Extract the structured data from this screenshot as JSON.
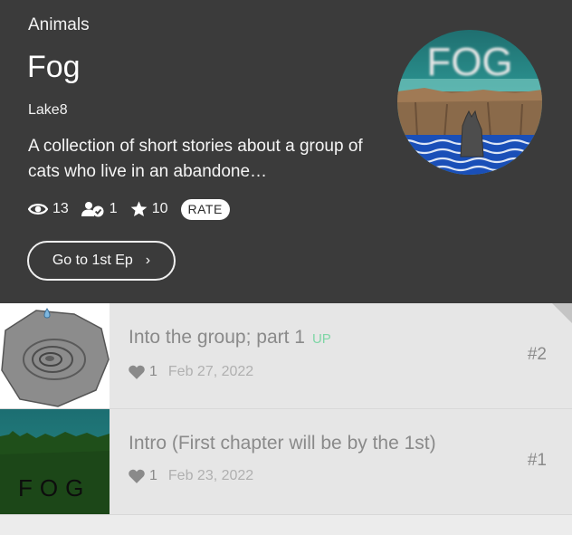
{
  "series": {
    "genre": "Animals",
    "title": "Fog",
    "author": "Lake8",
    "description": "A collection of short stories about a group of cats who live in an abandone…",
    "cover_text": "FOG",
    "stats": {
      "views": "13",
      "subscribers": "1",
      "likes": "10",
      "rate_label": "RATE"
    },
    "go_first_label": "Go to 1st Ep"
  },
  "episodes": [
    {
      "title": "Into the group; part 1",
      "badge": "UP",
      "likes": "1",
      "date": "Feb 27, 2022",
      "number": "#2"
    },
    {
      "title": "Intro (First chapter will be by the 1st)",
      "likes": "1",
      "date": "Feb 23, 2022",
      "number": "#1",
      "thumb_text": "FOG"
    }
  ],
  "colors": {
    "header_bg": "#3b3b3b",
    "list_bg": "#e6e6e6",
    "up_badge": "#7fd6a6"
  }
}
